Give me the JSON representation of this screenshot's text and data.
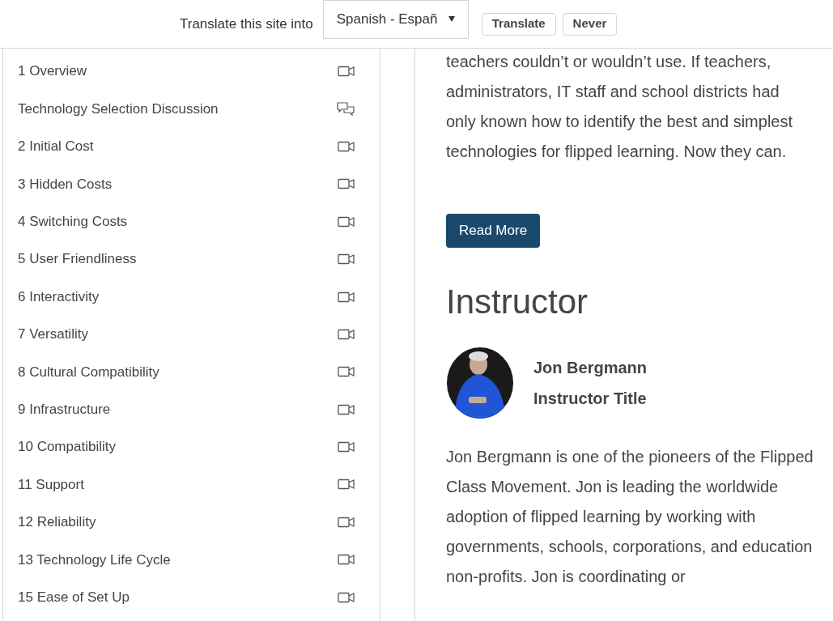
{
  "translate_bar": {
    "label": "Translate this site into",
    "language": "Spanish - Españ",
    "buttons": [
      "Translate",
      "Never"
    ]
  },
  "lessons": [
    {
      "title": "1 Overview",
      "kind": "video"
    },
    {
      "title": "Technology Selection Discussion",
      "kind": "discussion"
    },
    {
      "title": "2 Initial Cost",
      "kind": "video"
    },
    {
      "title": "3 Hidden Costs",
      "kind": "video"
    },
    {
      "title": "4 Switching Costs",
      "kind": "video"
    },
    {
      "title": "5 User Friendliness",
      "kind": "video"
    },
    {
      "title": "6 Interactivity",
      "kind": "video"
    },
    {
      "title": "7 Versatility",
      "kind": "video"
    },
    {
      "title": "8 Cultural Compatibility",
      "kind": "video"
    },
    {
      "title": "9 Infrastructure",
      "kind": "video"
    },
    {
      "title": "10 Compatibility",
      "kind": "video"
    },
    {
      "title": "11 Support",
      "kind": "video"
    },
    {
      "title": "12 Reliability",
      "kind": "video"
    },
    {
      "title": "13 Technology Life Cycle",
      "kind": "video"
    },
    {
      "title": "15 Ease of Set Up",
      "kind": "video"
    }
  ],
  "description": "teachers couldn’t or wouldn’t use. If teachers, administrators, IT staff and school districts had only known how to identify the best and simplest technologies for flipped learning. Now they can.",
  "read_more": "Read More",
  "instructor": {
    "heading": "Instructor",
    "name": "Jon Bergmann",
    "title": "Instructor Title",
    "bio": "Jon Bergmann is one of the pioneers of the Flipped Class Movement. Jon is leading the worldwide adoption of flipped learning by working with governments, schools, corporations, and education non-profits. Jon is coordinating or"
  }
}
